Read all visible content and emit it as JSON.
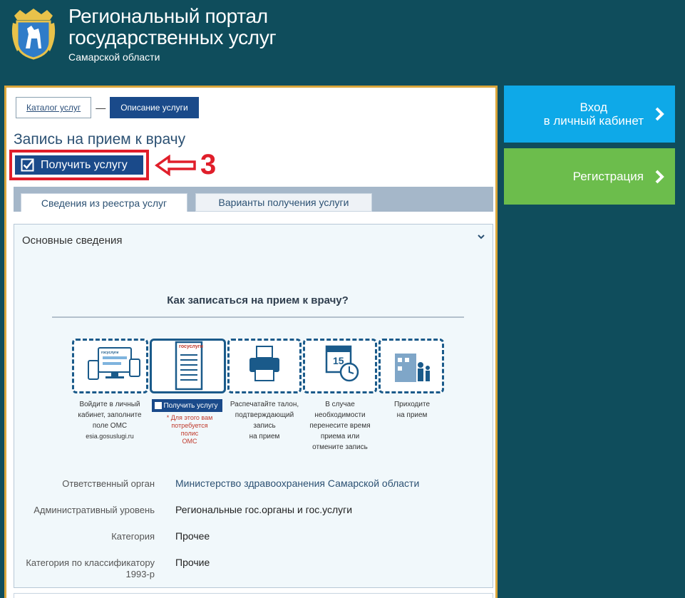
{
  "header": {
    "title_line1": "Региональный портал",
    "title_line2": "государственных услуг",
    "subtitle": "Самарской области"
  },
  "breadcrumbs": {
    "catalog": "Каталог услуг",
    "separator": "—",
    "current": "Описание услуги"
  },
  "service": {
    "title": "Запись на прием к врачу",
    "get_button": "Получить услугу",
    "annotation_number": "3"
  },
  "tabs": [
    {
      "label": "Сведения из реестра услуг",
      "active": true
    },
    {
      "label": "Варианты получения услуги",
      "active": false
    }
  ],
  "info": {
    "section_title": "Основные сведения",
    "infographic": {
      "title": "Как записаться на прием к врачу?",
      "step1_caption": [
        "Войдите в личный",
        "кабинет, заполните",
        "поле ОМС",
        "esia.gosuslugi.ru"
      ],
      "step2_button": "Получить услугу",
      "step2_note": [
        "* Для этого вам",
        "потребуется полис",
        "ОМС"
      ],
      "step3_caption": [
        "Распечатайте талон,",
        "подтверждающий",
        "запись",
        "на прием"
      ],
      "step4_caption": [
        "В случае",
        "необходимости",
        "перенесите время",
        "приема или",
        "отмените запись"
      ],
      "step5_caption": [
        "Приходите",
        "на прием"
      ],
      "gosuslugi_small": "госуслуги",
      "gosuslugi_doc": "госуслуги",
      "calendar_day": "15"
    },
    "rows": [
      {
        "label": "Ответственный орган",
        "value": "Министерство здравоохранения Самарской области"
      },
      {
        "label": "Административный уровень",
        "value": "Региональные гос.органы и гос.услуги"
      },
      {
        "label": "Категория",
        "value": "Прочее"
      },
      {
        "label_line1": "Категория по классификатору",
        "label_line2": "1993-р",
        "value": "Прочие"
      }
    ]
  },
  "sidebar": {
    "login_line1": "Вход",
    "login_line2": "в личный кабинет",
    "register": "Регистрация"
  },
  "colors": {
    "background": "#0f4d5c",
    "accent_blue": "#1a4a8a",
    "login_btn": "#0ea9e8",
    "register_btn": "#6cbd4c",
    "annotation_red": "#e01e2a",
    "panel_border": "#d9a53a"
  }
}
